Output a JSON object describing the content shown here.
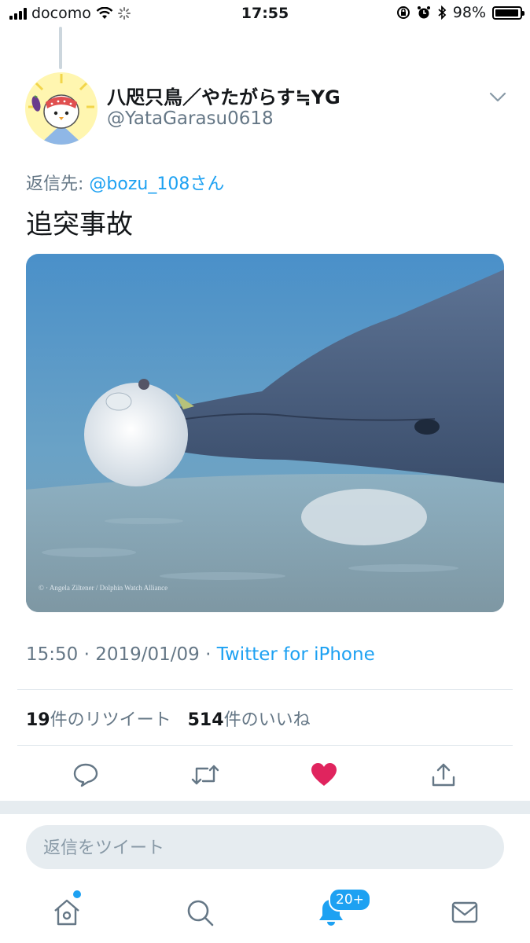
{
  "status_bar": {
    "carrier": "docomo",
    "time": "17:55",
    "battery_text": "98%",
    "battery_level": 0.98
  },
  "tweet": {
    "display_name": "八咫只鳥／やたがらす≒YG",
    "handle": "@YataGarasu0618",
    "reply_prefix": "返信先: ",
    "reply_mention": "@bozu_108さん",
    "text": "追突事故",
    "photo_credit": "© · Angela Ziltener / Dolphin Watch Alliance",
    "time": "15:50",
    "separator": " · ",
    "date": "2019/01/09",
    "source": "Twitter for iPhone",
    "retweet_count": "19",
    "retweet_label": "件のリツイート",
    "like_count": "514",
    "like_label": "件のいいね"
  },
  "actions": {
    "reply_icon": "comment-bubble-icon",
    "retweet_icon": "retweet-icon",
    "like_icon": "heart-icon",
    "share_icon": "share-icon"
  },
  "reply_bar": {
    "placeholder": "返信をツイート"
  },
  "tab_bar": {
    "notifications_badge": "20+"
  },
  "colors": {
    "accent": "#1da1f2",
    "like": "#e0245e",
    "secondary_text": "#657786",
    "divider": "#e1e8ed"
  }
}
